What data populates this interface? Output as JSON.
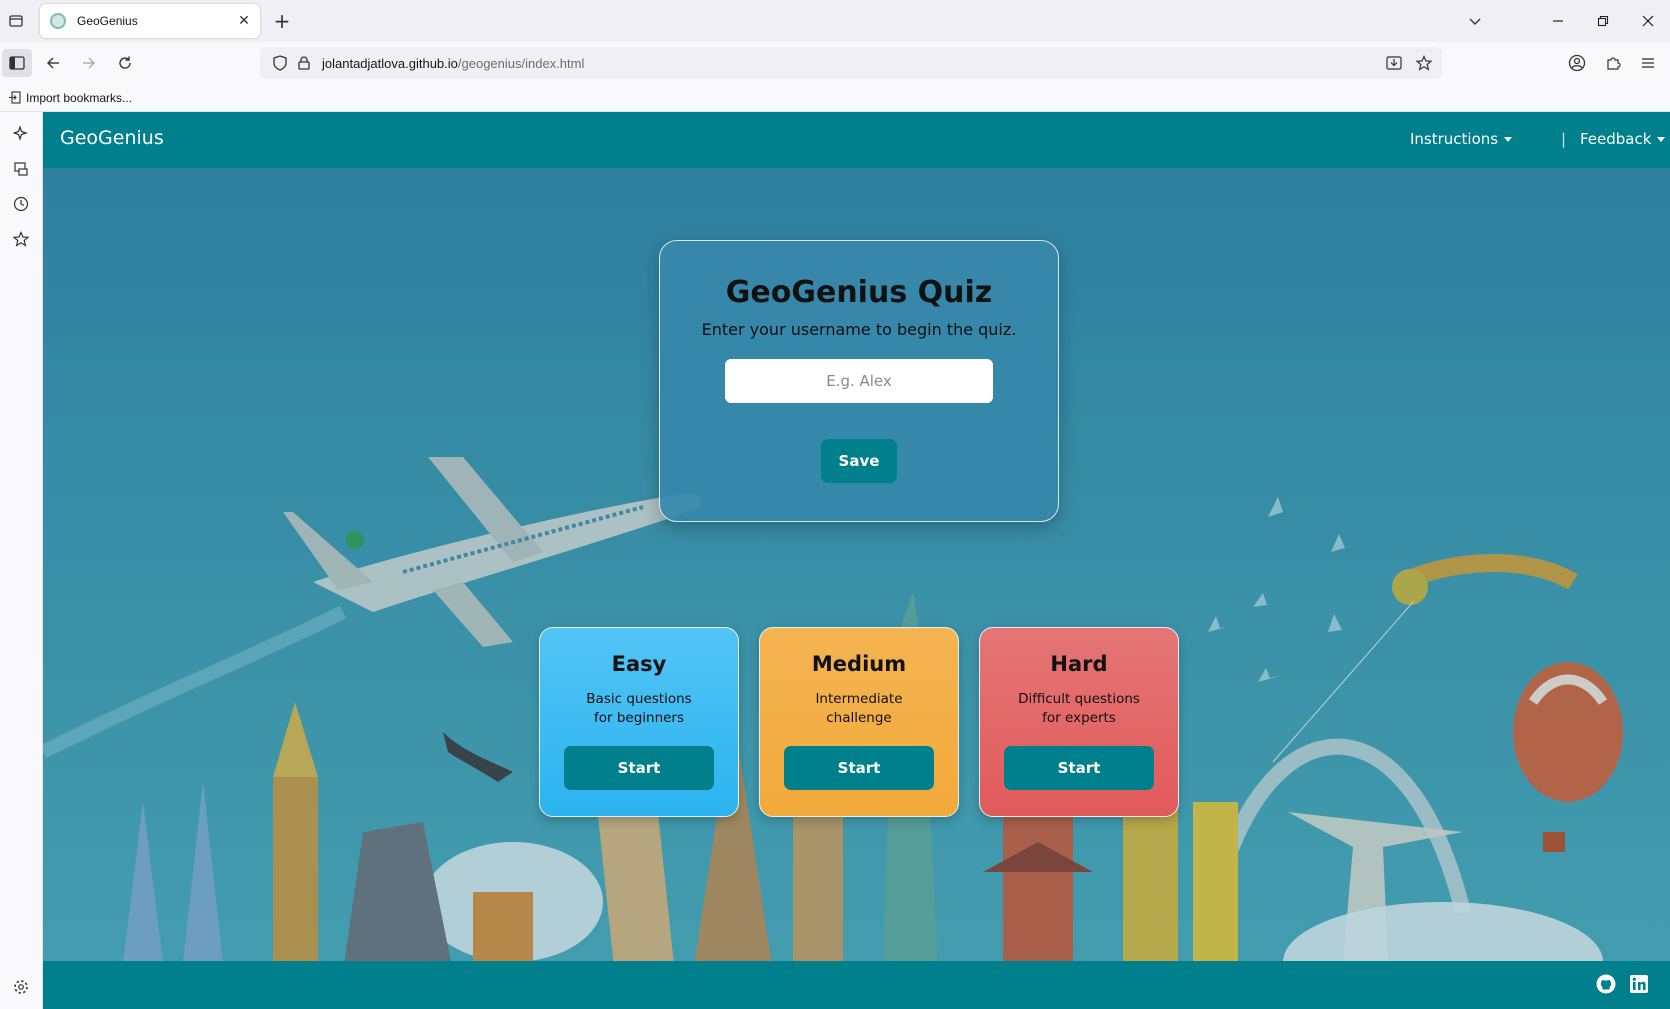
{
  "browser": {
    "tab_title": "GeoGenius",
    "url_host": "jolantadjatlova.github.io",
    "url_path": "/geogenius/index.html",
    "bookmarks_label": "Import bookmarks..."
  },
  "site": {
    "brand": "GeoGenius",
    "nav": {
      "instructions": "Instructions",
      "separator": "|",
      "feedback": "Feedback"
    }
  },
  "quiz": {
    "title": "GeoGenius Quiz",
    "subtitle": "Enter your username to begin the quiz.",
    "username_placeholder": "E.g. Alex",
    "save_label": "Save"
  },
  "levels": [
    {
      "title": "Easy",
      "desc_line1": "Basic questions",
      "desc_line2": "for beginners",
      "button": "Start"
    },
    {
      "title": "Medium",
      "desc_line1": "Intermediate",
      "desc_line2": "challenge",
      "button": "Start"
    },
    {
      "title": "Hard",
      "desc_line1": "Difficult questions",
      "desc_line2": "for experts",
      "button": "Start"
    }
  ],
  "colors": {
    "teal": "#00808c",
    "easy": "#2cb3ef",
    "medium": "#f1a93a",
    "hard": "#e15a5a"
  }
}
